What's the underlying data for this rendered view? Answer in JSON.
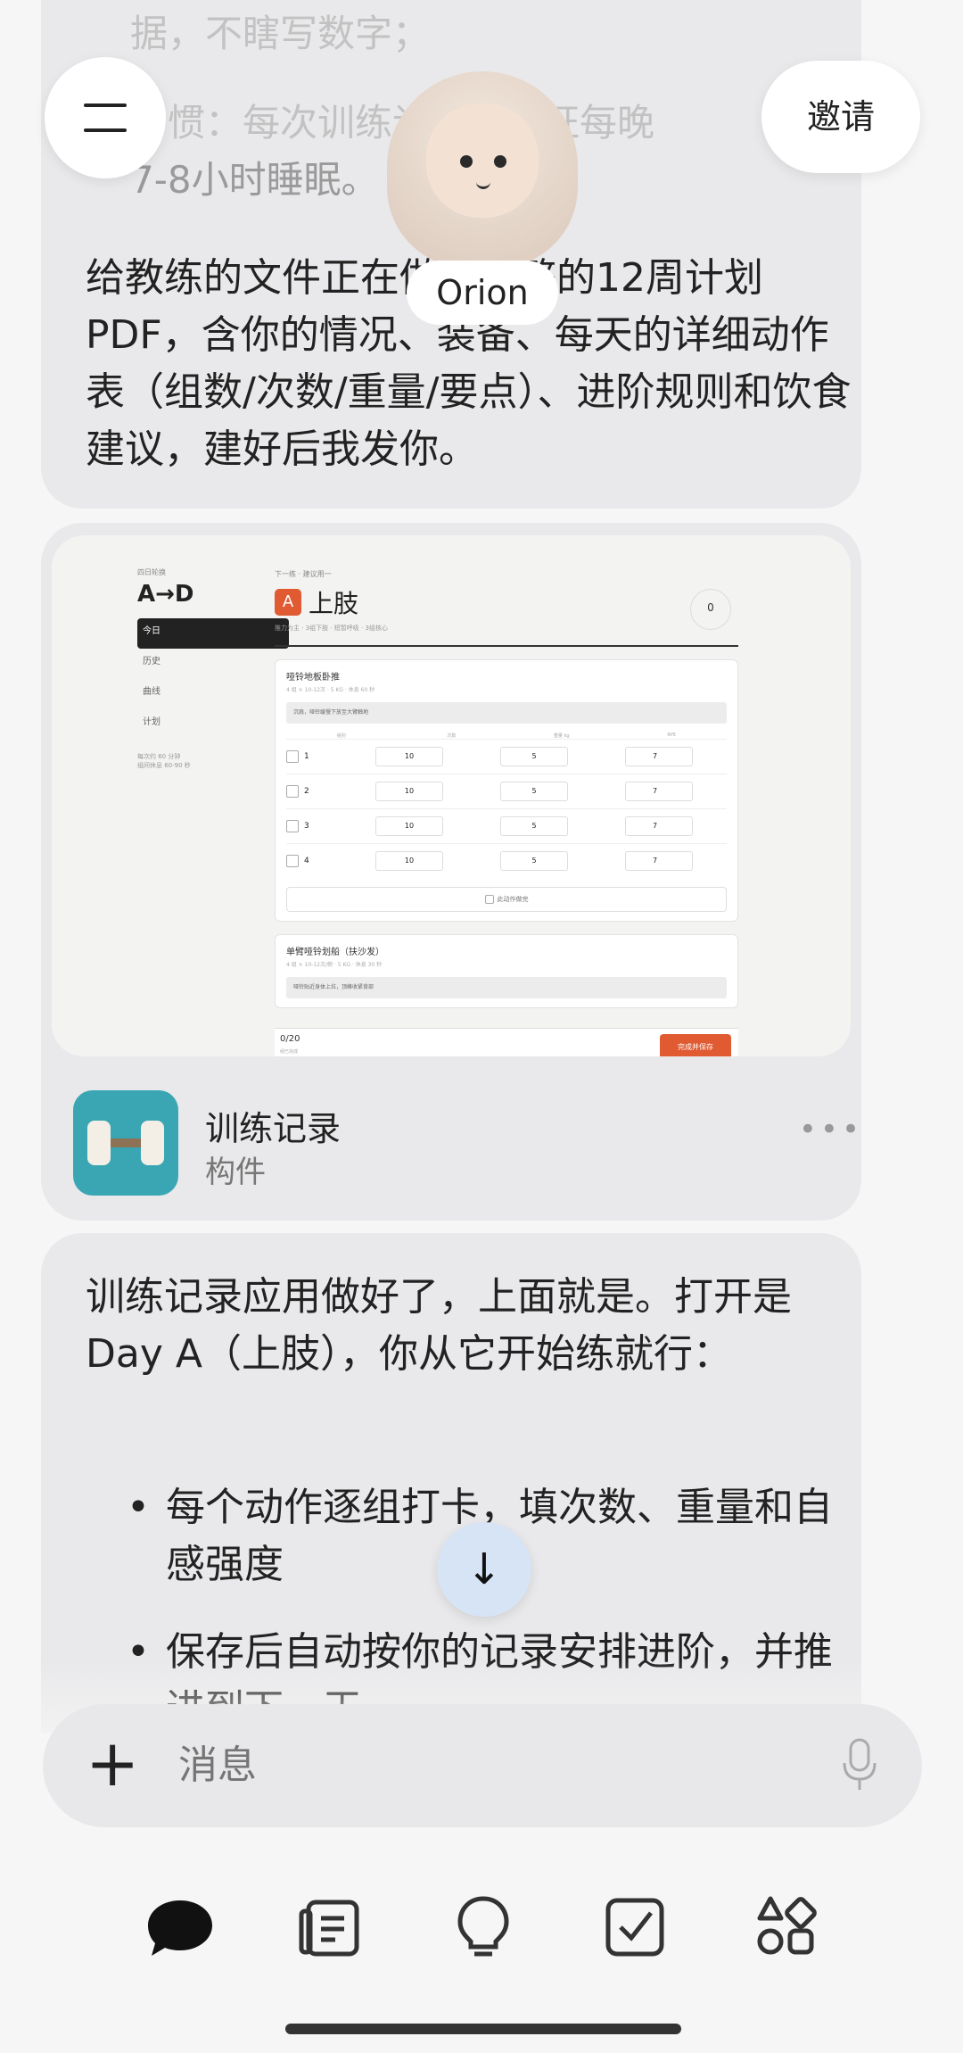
{
  "header": {
    "menu_icon": "hamburger-icon",
    "invite_label": "邀请",
    "agent_name": "Orion"
  },
  "chat": {
    "msg1": {
      "faded_line1": "据，不瞎写数字；",
      "faded_line2": "习惯：每次训练记录，保证每晚",
      "faded_line3": "7-8小时睡眠。",
      "text": "给教练的文件正在做：完整的12周计划PDF，含你的情况、装备、每天的详细动作表（组数/次数/重量/要点）、进阶规则和饮食建议，建好后我发你。"
    },
    "artifact": {
      "preview": {
        "kicker": "四日轮换",
        "rotation": "A→D",
        "nav": [
          "今日",
          "历史",
          "曲线",
          "计划"
        ],
        "side_note": "每次约 60 分钟\n组间休息 60-90 秒",
        "day_kicker": "下一练 · 建议用一",
        "day_badge": "A",
        "day_title": "上肢",
        "day_sub": "推力为主 · 3组下肢 · 短暂呼吸 · 3组核心",
        "count": "0",
        "exercise1": {
          "name": "哑铃地板卧推",
          "meta": "4 组 × 10-12次 · 5 KG · 休息 60 秒",
          "tip": "沉肩，哑铃缓慢下放至大臂触地",
          "columns": [
            "组别",
            "次数",
            "重量 kg",
            "RPE"
          ],
          "rows": [
            {
              "set": "1",
              "reps": "10",
              "weight": "5",
              "rpe": "7"
            },
            {
              "set": "2",
              "reps": "10",
              "weight": "5",
              "rpe": "7"
            },
            {
              "set": "3",
              "reps": "10",
              "weight": "5",
              "rpe": "7"
            },
            {
              "set": "4",
              "reps": "10",
              "weight": "5",
              "rpe": "7"
            }
          ],
          "done_label": "此动作做完"
        },
        "exercise2": {
          "name": "单臂哑铃划船（扶沙发）",
          "meta": "4 组 × 10-12次/侧 · 5 KG · 休息 30 秒",
          "tip": "哑铃贴近身体上拉，顶峰收紧背部"
        },
        "footer_count": "0/20",
        "footer_sub": "组已完成",
        "footer_button": "完成并保存"
      },
      "name": "训练记录",
      "type": "构件",
      "more_icon": "more-horizontal-icon"
    },
    "msg2": {
      "text": "训练记录应用做好了，上面就是。打开是 Day A（上肢），你从它开始练就行：",
      "bullets": [
        "每个动作逐组打卡，填次数、重量和自感强度",
        "保存后自动按你的记录安排进阶，并推进到下一天"
      ],
      "bullet_char": "•"
    }
  },
  "composer": {
    "placeholder": "消息",
    "plus_icon": "plus-icon",
    "plus_glyph": "+",
    "mic_icon": "mic-icon"
  },
  "scroll_button": {
    "icon": "arrow-down-icon",
    "glyph": "↓"
  },
  "bottom_nav": {
    "items": [
      "chat-icon",
      "notes-icon",
      "lightbulb-icon",
      "checkbox-icon",
      "apps-icon"
    ]
  },
  "colors": {
    "accent": "#e05a32",
    "app_icon_bg": "#3aa6b4",
    "bubble": "#e9e9eb",
    "scroll_btn": "#d6e4f5"
  }
}
